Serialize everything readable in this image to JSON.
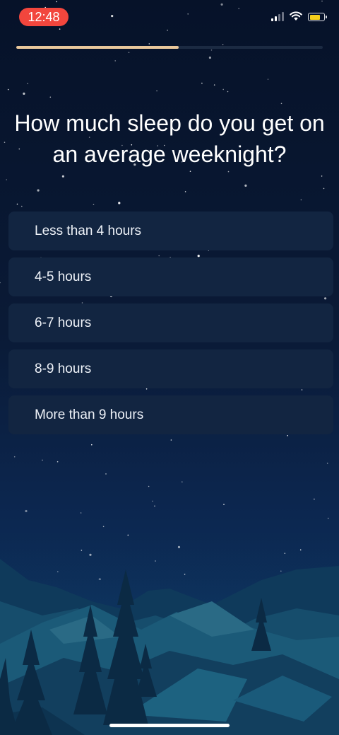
{
  "status": {
    "time": "12:48",
    "icons": [
      "cellular-signal-icon",
      "wifi-icon",
      "battery-icon"
    ],
    "battery_color": "#f5cf1c",
    "time_pill_color": "#f2463d"
  },
  "progress": {
    "value_percent": 53,
    "color": "#e8c79b"
  },
  "question": "How much sleep do you get on an average weeknight?",
  "options": [
    {
      "label": "Less than 4 hours"
    },
    {
      "label": "4-5 hours"
    },
    {
      "label": "6-7 hours"
    },
    {
      "label": "8-9 hours"
    },
    {
      "label": "More than 9 hours"
    }
  ],
  "background": {
    "sky_top": "#061229",
    "sky_bottom": "#0e3a66",
    "option_bg": "#122541"
  }
}
